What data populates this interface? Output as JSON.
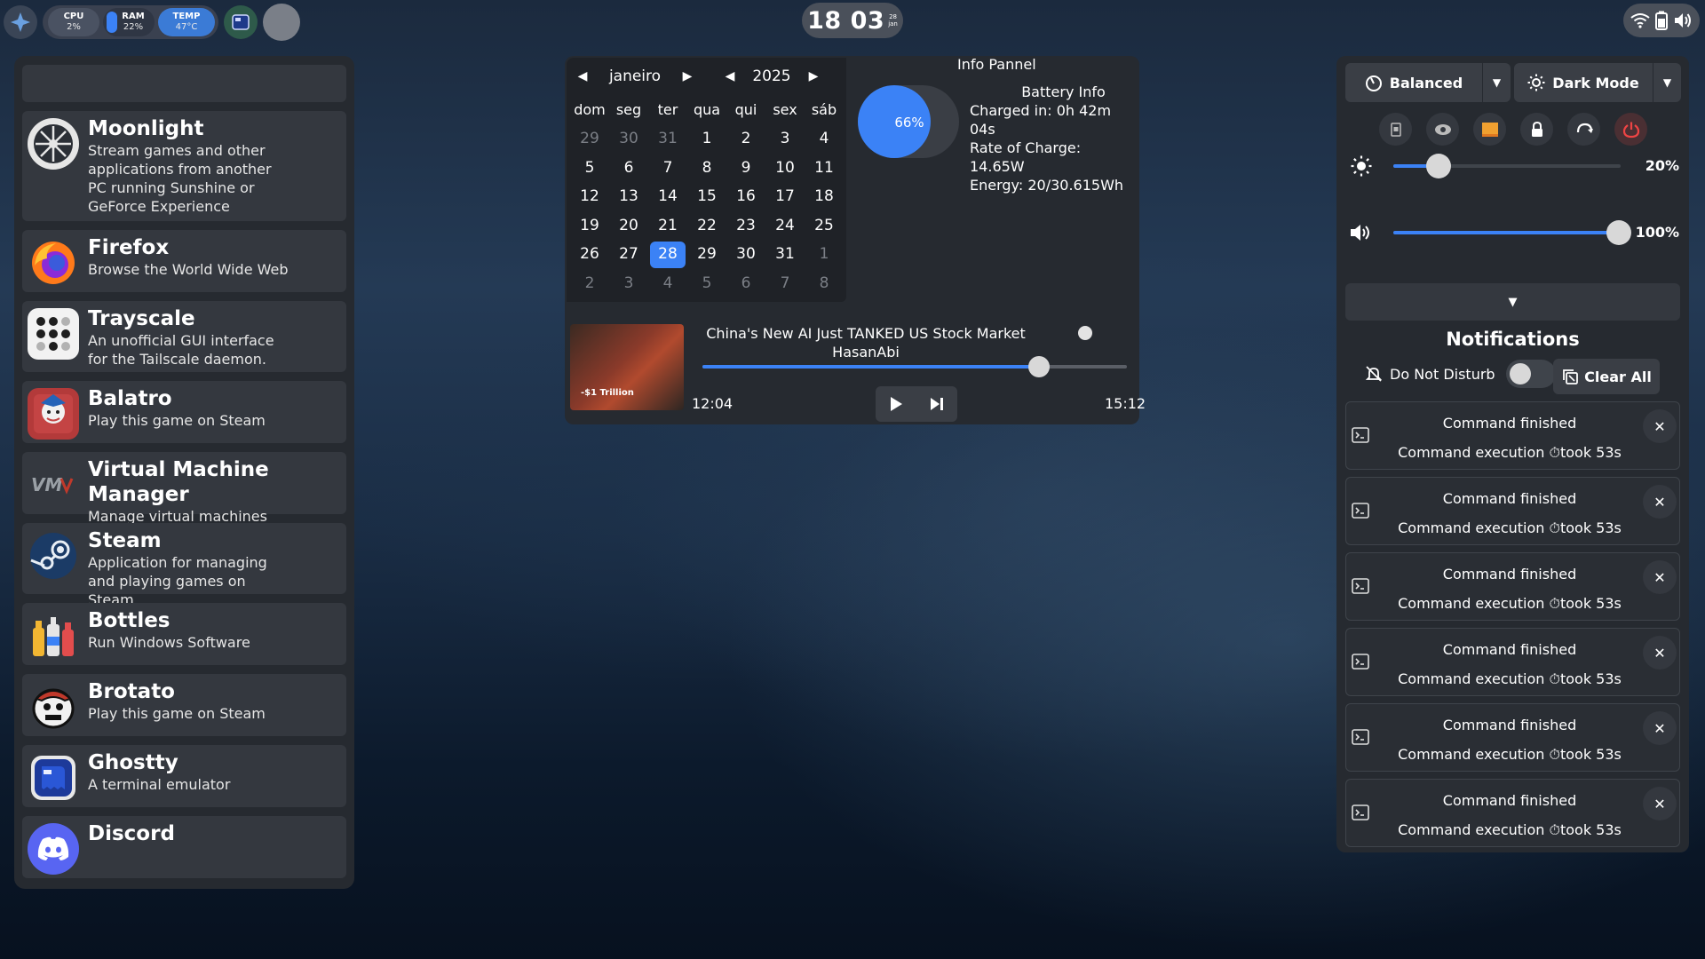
{
  "topbar": {
    "stats": [
      {
        "label": "CPU",
        "value": "2%"
      },
      {
        "label": "RAM",
        "value": "22%",
        "level": 0.22
      },
      {
        "label": "TEMP",
        "value": "47°C"
      }
    ],
    "clock": {
      "time": "18 03",
      "day": "28",
      "month": "jan"
    },
    "tray_icons": [
      "wifi-icon",
      "battery-icon",
      "volume-icon"
    ]
  },
  "launcher": {
    "apps": [
      {
        "name": "Moonlight",
        "desc": "Stream games and other applications from another PC running Sunshine or GeForce Experience",
        "icon": "moonlight-icon"
      },
      {
        "name": "Firefox",
        "desc": "Browse the World Wide Web",
        "icon": "firefox-icon"
      },
      {
        "name": "Trayscale",
        "desc": "An unofficial GUI interface for the Tailscale daemon.",
        "icon": "trayscale-icon"
      },
      {
        "name": "Balatro",
        "desc": "Play this game on Steam",
        "icon": "balatro-icon"
      },
      {
        "name": "Virtual Machine Manager",
        "desc": "Manage virtual machines",
        "icon": "virt-manager-icon"
      },
      {
        "name": "Steam",
        "desc": "Application for managing and playing games on Steam",
        "icon": "steam-icon"
      },
      {
        "name": "Bottles",
        "desc": "Run Windows Software",
        "icon": "bottles-icon"
      },
      {
        "name": "Brotato",
        "desc": "Play this game on Steam",
        "icon": "brotato-icon"
      },
      {
        "name": "Ghostty",
        "desc": "A terminal emulator",
        "icon": "ghostty-icon"
      },
      {
        "name": "Discord",
        "desc": "",
        "icon": "discord-icon"
      }
    ]
  },
  "calendar": {
    "month": "janeiro",
    "year": "2025",
    "weekdays": [
      "dom",
      "seg",
      "ter",
      "qua",
      "qui",
      "sex",
      "sáb"
    ],
    "days": [
      {
        "d": "29",
        "dim": true
      },
      {
        "d": "30",
        "dim": true
      },
      {
        "d": "31",
        "dim": true
      },
      {
        "d": "1"
      },
      {
        "d": "2"
      },
      {
        "d": "3"
      },
      {
        "d": "4"
      },
      {
        "d": "5"
      },
      {
        "d": "6"
      },
      {
        "d": "7"
      },
      {
        "d": "8"
      },
      {
        "d": "9"
      },
      {
        "d": "10"
      },
      {
        "d": "11"
      },
      {
        "d": "12"
      },
      {
        "d": "13"
      },
      {
        "d": "14"
      },
      {
        "d": "15"
      },
      {
        "d": "16"
      },
      {
        "d": "17"
      },
      {
        "d": "18"
      },
      {
        "d": "19"
      },
      {
        "d": "20"
      },
      {
        "d": "21"
      },
      {
        "d": "22"
      },
      {
        "d": "23"
      },
      {
        "d": "24"
      },
      {
        "d": "25"
      },
      {
        "d": "26"
      },
      {
        "d": "27"
      },
      {
        "d": "28",
        "today": true
      },
      {
        "d": "29"
      },
      {
        "d": "30"
      },
      {
        "d": "31"
      },
      {
        "d": "1",
        "dim": true
      },
      {
        "d": "2",
        "dim": true
      },
      {
        "d": "3",
        "dim": true
      },
      {
        "d": "4",
        "dim": true
      },
      {
        "d": "5",
        "dim": true
      },
      {
        "d": "6",
        "dim": true
      },
      {
        "d": "7",
        "dim": true
      },
      {
        "d": "8",
        "dim": true
      }
    ]
  },
  "info_panel": {
    "title": "Info Pannel",
    "battery": {
      "percent_label": "66%",
      "level": 0.66,
      "title": "Battery Info",
      "charged_in": "Charged in: 0h 42m 04s",
      "rate": "Rate of Charge: 14.65W",
      "energy": "Energy: 20/30.615Wh"
    }
  },
  "media": {
    "title": "China's New AI Just TANKED US Stock Market",
    "artist": "HasanAbi",
    "thumb_caption": "-$1 Trillion",
    "current": "12:04",
    "total": "15:12",
    "progress": 0.792
  },
  "controls": {
    "power_profile": "Balanced",
    "theme": "Dark Mode",
    "quick_icons": [
      "screenshot-icon",
      "record-icon",
      "display-icon",
      "lock-icon",
      "restart-icon",
      "power-icon"
    ],
    "brightness": {
      "label": "20%",
      "level": 0.2
    },
    "volume": {
      "label": "100%",
      "level": 1.0
    }
  },
  "notifications": {
    "title": "Notifications",
    "dnd_label": "Do Not Disturb",
    "clear_label": "Clear All",
    "items": [
      {
        "title": "Command finished",
        "body": "Command execution ⏱took 53s"
      },
      {
        "title": "Command finished",
        "body": "Command execution ⏱took 53s"
      },
      {
        "title": "Command finished",
        "body": "Command execution ⏱took 53s"
      },
      {
        "title": "Command finished",
        "body": "Command execution ⏱took 53s"
      },
      {
        "title": "Command finished",
        "body": "Command execution ⏱took 53s"
      },
      {
        "title": "Command finished",
        "body": "Command execution ⏱took 53s"
      }
    ]
  },
  "colors": {
    "accent": "#3b82f6",
    "panel": "#262a30",
    "item": "#34383f"
  }
}
